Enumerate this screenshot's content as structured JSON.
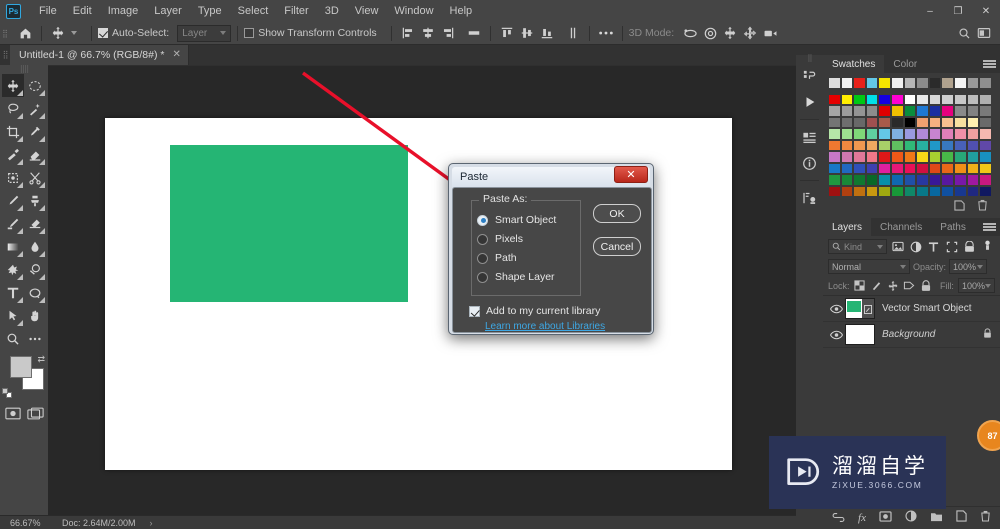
{
  "app": {
    "logo": "Ps",
    "menus": [
      "File",
      "Edit",
      "Image",
      "Layer",
      "Type",
      "Select",
      "Filter",
      "3D",
      "View",
      "Window",
      "Help"
    ],
    "window_buttons": [
      {
        "name": "minimize",
        "glyph": "–"
      },
      {
        "name": "restore",
        "glyph": "❐"
      },
      {
        "name": "close",
        "glyph": "✕"
      }
    ]
  },
  "options_bar": {
    "home_icon": "home-icon",
    "tool_icon": "move-tool-icon",
    "auto_select_label": "Auto-Select:",
    "auto_select_checked": true,
    "layer_dropdown_value": "Layer",
    "show_transform_label": "Show Transform Controls",
    "show_transform_checked": false,
    "align_icons": [
      "align-left-edges",
      "align-horizontal-centers",
      "align-right-edges",
      "distribute-horizontally"
    ],
    "align_icons2": [
      "align-top-edges",
      "align-vertical-centers",
      "align-bottom-edges",
      "distribute-vertically"
    ],
    "more_label": "•••",
    "mode_3d_label": "3D Mode:",
    "mode_3d_icons": [
      "orbit-3d",
      "roll-3d",
      "pan-3d",
      "slide-3d",
      "scale-3d"
    ],
    "search_icon": "search-icon",
    "arrange_icon": "arrange-documents-icon"
  },
  "document": {
    "tab_title": "Untitled-1 @ 66.7% (RGB/8#) *",
    "close_glyph": "✕"
  },
  "toolbar": {
    "tools": [
      {
        "name": "move-tool",
        "active": true
      },
      {
        "name": "elliptical-marquee-tool",
        "active": false
      },
      {
        "name": "lasso-tool",
        "active": false
      },
      {
        "name": "magic-wand-tool",
        "active": false
      },
      {
        "name": "crop-tool",
        "active": false
      },
      {
        "name": "eyedropper-tool",
        "active": false
      },
      {
        "name": "healing-brush-tool",
        "active": false
      },
      {
        "name": "eraser-tool",
        "active": false
      },
      {
        "name": "patch-tool",
        "active": false
      },
      {
        "name": "scissors-tool",
        "active": false
      },
      {
        "name": "brush-tool",
        "active": false
      },
      {
        "name": "clone-stamp-tool",
        "active": false
      },
      {
        "name": "history-brush-tool",
        "active": false
      },
      {
        "name": "gradient-eraser-tool",
        "active": false
      },
      {
        "name": "gradient-tool",
        "active": false
      },
      {
        "name": "blur-tool",
        "active": false
      },
      {
        "name": "dodge-tool",
        "active": false
      },
      {
        "name": "burn-tool",
        "active": false
      },
      {
        "name": "type-tool",
        "active": false
      },
      {
        "name": "shape-tool",
        "active": false
      },
      {
        "name": "path-selection-tool",
        "active": false
      },
      {
        "name": "hand-tool",
        "active": false
      },
      {
        "name": "zoom-tool",
        "active": false
      },
      {
        "name": "more-tools",
        "active": false
      }
    ],
    "foreground_color": "#c9c9c9",
    "background_color": "#ffffff",
    "screen_modes": [
      "quick-mask-mode",
      "screen-mode"
    ]
  },
  "canvas": {
    "background": "#282828",
    "page_color": "#ffffff",
    "shape_color": "#25b574",
    "annotation_arrow_color": "#e8102a"
  },
  "status_bar": {
    "zoom": "66.67%",
    "doc_info": "Doc: 2.64M/2.00M",
    "expand_glyph": "›"
  },
  "rail": {
    "buttons": [
      "history-panel-icon",
      "play-action-icon",
      "properties-panel-icon",
      "info-panel-icon",
      "adjustments-panel-icon"
    ]
  },
  "swatches_panel": {
    "tabs": [
      {
        "label": "Swatches",
        "active": true
      },
      {
        "label": "Color",
        "active": false
      }
    ],
    "menu_icon": "panel-menu-icon",
    "rows": [
      [
        "#dedede",
        "#f2f2f2",
        "#e8211a",
        "#63c8e8",
        "#f5e500",
        "#f0f0f0",
        "#b6b6b6",
        "#8c8c8c",
        "#2b2b2b",
        "#b0a28e",
        "#f4f4f4",
        "#9a9a9a",
        "#8e8e8e"
      ],
      [
        "#e50000",
        "#ffee00",
        "#00c814",
        "#00e0e8",
        "#1400e0",
        "#ff00d2",
        "#ffffff",
        "#e8e8e8",
        "#d8d8d8",
        "#cfcfcf",
        "#c8c8c8",
        "#bdbdbd",
        "#b0b0b0"
      ],
      [
        "#a5a5a5",
        "#9c9c9c",
        "#949494",
        "#8c8c8c",
        "#e00000",
        "#f0c000",
        "#0a8c3c",
        "#1e78d2",
        "#1a2ea0",
        "#e6007e",
        "#8a8a8a",
        "#828282",
        "#7a7a7a"
      ],
      [
        "#747474",
        "#6e6e6e",
        "#686868",
        "#a05050",
        "#a85a4a",
        "#2a2a2a",
        "#000000",
        "#f0a070",
        "#f5b080",
        "#f8c090",
        "#f7e0a0",
        "#fff0b0",
        "#6a6a6a"
      ],
      [
        "#b6e6a8",
        "#9ee090",
        "#7fd878",
        "#5fd0a0",
        "#64c8e6",
        "#7fb0e0",
        "#9a9ae0",
        "#b08ad8",
        "#c884d0",
        "#e080b8",
        "#f090a8",
        "#f0a0a0",
        "#f5b8b0"
      ],
      [
        "#f07830",
        "#f08840",
        "#f09850",
        "#f0a860",
        "#a8d068",
        "#60c060",
        "#30b878",
        "#28b0a0",
        "#2098c8",
        "#3878c0",
        "#4860b8",
        "#5050b0",
        "#6048a8"
      ],
      [
        "#c878c8",
        "#d078b0",
        "#e07898",
        "#f07888",
        "#e01818",
        "#f05818",
        "#f07818",
        "#f8d818",
        "#a8d030",
        "#48b848",
        "#28a878",
        "#20a0a0",
        "#1890c0"
      ],
      [
        "#1878c8",
        "#2068c0",
        "#3050b8",
        "#4040b0",
        "#e020a0",
        "#e81878",
        "#e81058",
        "#d01040",
        "#e04818",
        "#e86818",
        "#f09018",
        "#f0b018",
        "#f0c818"
      ],
      [
        "#209840",
        "#188838",
        "#107830",
        "#086828",
        "#0890a8",
        "#1068b0",
        "#2050a8",
        "#2838a0",
        "#381898",
        "#5818a0",
        "#7818a8",
        "#a018a0",
        "#c81880"
      ],
      [
        "#a01010",
        "#b04010",
        "#c07010",
        "#c89810",
        "#a0a810",
        "#189838",
        "#108868",
        "#087888",
        "#0868a0",
        "#1050a0",
        "#183890",
        "#202880",
        "#101860"
      ]
    ],
    "footer_icons": [
      "new-swatch-icon",
      "delete-swatch-icon"
    ]
  },
  "layers_panel": {
    "tabs": [
      {
        "label": "Layers",
        "active": true
      },
      {
        "label": "Channels",
        "active": false
      },
      {
        "label": "Paths",
        "active": false
      }
    ],
    "menu_icon": "panel-menu-icon",
    "filter": {
      "search_icon": "search-icon",
      "kind_label": "Kind",
      "icons": [
        "filter-image-icon",
        "filter-adjustment-icon",
        "filter-type-icon",
        "filter-shape-icon",
        "filter-smart-object-icon",
        "filter-toggle-icon"
      ]
    },
    "blend_mode": "Normal",
    "opacity_label": "Opacity:",
    "opacity_value": "100%",
    "lock_label": "Lock:",
    "lock_icons": [
      "lock-transparent-pixels-icon",
      "lock-image-pixels-icon",
      "lock-position-icon",
      "lock-artboard-icon",
      "lock-all-icon"
    ],
    "fill_label": "Fill:",
    "fill_value": "100%",
    "layers": [
      {
        "name": "Vector Smart Object",
        "visible": true,
        "selected": false,
        "italic": false,
        "locked": false,
        "thumb": "smart-object"
      },
      {
        "name": "Background",
        "visible": true,
        "selected": false,
        "italic": true,
        "locked": true,
        "thumb": "white"
      }
    ],
    "footer_icons": [
      "link-layers-icon",
      "layer-style-fx-icon",
      "layer-mask-icon",
      "adjustment-layer-icon",
      "new-group-icon",
      "new-layer-icon",
      "delete-layer-icon"
    ]
  },
  "dialog": {
    "title": "Paste",
    "close_glyph": "✕",
    "group_label": "Paste As:",
    "options": [
      {
        "label": "Smart Object",
        "selected": true
      },
      {
        "label": "Pixels",
        "selected": false
      },
      {
        "label": "Path",
        "selected": false
      },
      {
        "label": "Shape Layer",
        "selected": false
      }
    ],
    "ok_label": "OK",
    "cancel_label": "Cancel",
    "library_checkbox_label": "Add to my current library",
    "library_checked": true,
    "link_label": "Learn more about Libraries"
  },
  "watermark": {
    "logo_icon": "play-button-logo",
    "title_cn": "溜溜自学",
    "url": "ZiXUE.3066.COM",
    "badge_text": "87"
  }
}
